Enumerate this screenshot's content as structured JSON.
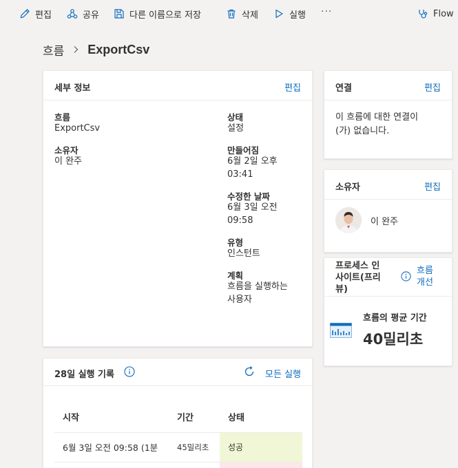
{
  "toolbar": {
    "edit": "편집",
    "share": "공유",
    "save_as": "다른 이름으로 저장",
    "delete": "삭제",
    "run": "실행",
    "more": "···",
    "flow_checker": "Flow"
  },
  "breadcrumb": {
    "root": "흐름",
    "current": "ExportCsv"
  },
  "details": {
    "title": "세부 정보",
    "edit": "편집",
    "flow_label": "흐름",
    "flow_value": "ExportCsv",
    "owner_label": "소유자",
    "owner_value": "이 완주",
    "status_label": "상태",
    "status_value": "설정",
    "created_label": "만들어짐",
    "created_value_1": "6월 2일 오후",
    "created_value_2": "03:41",
    "modified_label": "수정한 날짜",
    "modified_value_1": "6월 3일 오전",
    "modified_value_2": "09:58",
    "type_label": "유형",
    "type_value": "인스턴트",
    "plan_label": "계획",
    "plan_value_1": "흐름을 실행하는",
    "plan_value_2": "사용자"
  },
  "connections": {
    "title": "연결",
    "edit": "편집",
    "message_1": "이 흐름에 대한 연결이",
    "message_2": "(가) 없습니다."
  },
  "owners": {
    "title": "소유자",
    "edit": "편집",
    "owner_name": "이 완주"
  },
  "insights": {
    "title_1": "프로세스 인",
    "title_2": "사이트(프리",
    "title_3": "뷰)",
    "link_1": "흐름",
    "link_2": "개선",
    "metric_label": "흐름의 평균 기간",
    "metric_value": "40밀리초"
  },
  "runs": {
    "title": "28일 실행 기록",
    "all_runs": "모든 실행",
    "columns": [
      "시작",
      "기간",
      "상태"
    ],
    "rows": [
      {
        "start": "6월 3일 오전 09:58 (1분",
        "duration": "45밀리초",
        "status": "성공"
      }
    ]
  },
  "colors": {
    "accent": "#0f6cbd",
    "success_bg": "#f1f7d6",
    "fail_bg": "#fde7e9"
  }
}
